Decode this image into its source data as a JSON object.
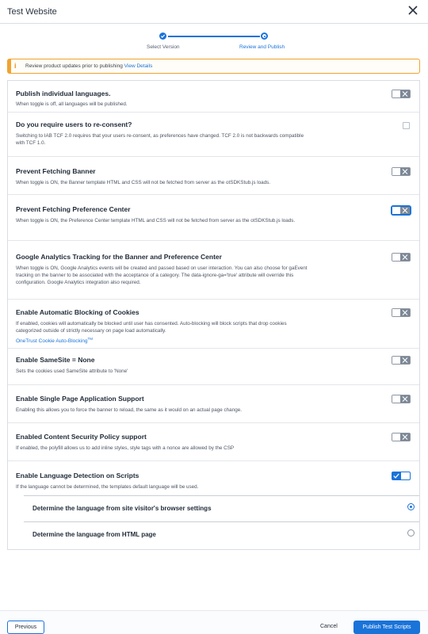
{
  "header": {
    "title": "Test Website",
    "close_icon": "close-icon"
  },
  "stepper": {
    "steps": [
      {
        "label": "Select Version",
        "state": "done"
      },
      {
        "label": "Review and Publish",
        "state": "current"
      }
    ]
  },
  "notice": {
    "icon": "info-icon",
    "text": "Review product updates prior to publishing",
    "link": "View Details"
  },
  "settings": [
    {
      "title": "Publish individual languages.",
      "description": "When toggle is off, all languages will be published.",
      "control": "toggle",
      "state": "off"
    },
    {
      "title": "Do you require users to re-consent?",
      "description": "Switching to IAB TCF 2.0 requires that your users re-consent, as preferences have changed. TCF 2.0 is not backwards compatible with TCF 1.0.",
      "control": "checkbox",
      "state": "unchecked"
    },
    {
      "title": "Prevent Fetching Banner",
      "description": "When toggle is ON, the Banner template HTML and CSS will not be fetched from server as the otSDKStub.js loads.",
      "control": "toggle",
      "state": "off"
    },
    {
      "title": "Prevent Fetching Preference Center",
      "description": "When toggle is ON, the Preference Center template HTML and CSS will not be fetched from server as the otSDKStub.js loads.",
      "control": "toggle",
      "state": "off-focused"
    },
    {
      "title": "Google Analytics Tracking for the Banner and Preference Center",
      "description": "When toggle is ON, Google Analytics events will be created and passed based on user interaction. You can also choose for gaEvent tracking on the banner to be associated with the acceptance of a category. The data-ignore-ga='true' attribute will override this configuration. Google Analytics integration also required.",
      "control": "toggle",
      "state": "off"
    },
    {
      "title": "Enable Automatic Blocking of Cookies",
      "description": "If enabled, cookies will automatically be blocked until user has consented. Auto-blocking will block scripts that drop cookies categorized outside of strictly necessary on page load automatically.",
      "link": "OneTrust Cookie Auto-Blocking",
      "link_sup": "TM",
      "control": "toggle",
      "state": "off"
    },
    {
      "title": "Enable SameSite = None",
      "description": "Sets the cookies used SameSite attribute to 'None'",
      "control": "toggle",
      "state": "off"
    },
    {
      "title": "Enable Single Page Application Support",
      "description": "Enabling this allows you to force the banner to reload, the same as it would on an actual page change.",
      "control": "toggle",
      "state": "off"
    },
    {
      "title": "Enabled Content Security Policy support",
      "description": "If enabled, the polyfill allows us to add inline styles, style tags with a nonce are allowed by the CSP",
      "control": "toggle",
      "state": "off"
    },
    {
      "title": "Enable Language Detection on Scripts",
      "description": "If the language cannot be determined, the templates default language will be used.",
      "control": "toggle",
      "state": "on"
    }
  ],
  "language_options": [
    {
      "label": "Determine the language from site visitor's browser settings",
      "selected": true
    },
    {
      "label": "Determine the language from HTML page",
      "selected": false
    }
  ],
  "footer": {
    "previous": "Previous",
    "cancel": "Cancel",
    "publish": "Publish Test Scripts"
  },
  "colors": {
    "accent": "#1a73d9",
    "warning": "#f0a331",
    "toggle_off": "#7d8896"
  }
}
